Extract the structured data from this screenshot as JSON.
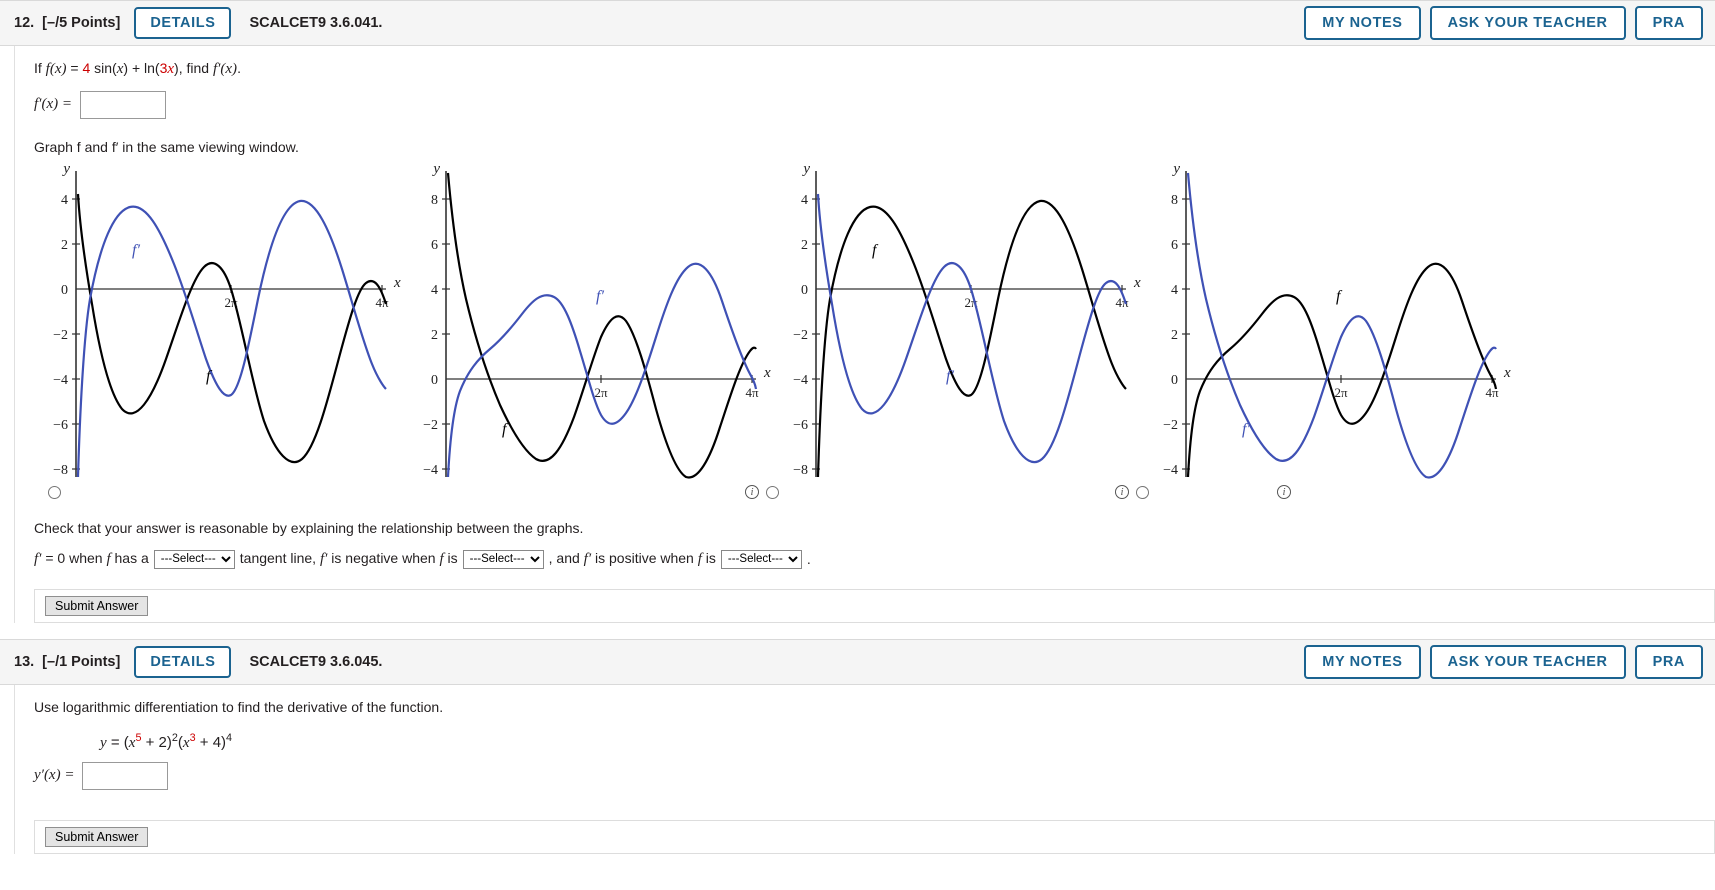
{
  "colors": {
    "accent_blue": "#1b6390",
    "curve_blue": "#3f51b5",
    "curve_black": "#000000",
    "red_text": "#cc0000",
    "header_bg": "#f5f5f5"
  },
  "questions": [
    {
      "number": "12.",
      "points": "[–/5 Points]",
      "details_label": "DETAILS",
      "code": "SCALCET9 3.6.041.",
      "header_buttons": [
        {
          "label": "MY NOTES"
        },
        {
          "label": "ASK YOUR TEACHER"
        },
        {
          "label": "PRA"
        }
      ],
      "prompt_parts": {
        "p1": "If ",
        "fx": "f(x)",
        "eq": " = ",
        "coef": "4",
        "sin": " sin(",
        "x1": "x",
        "mid": ") + ln(",
        "coef2": "3",
        "x2": "x",
        "tail": "), find ",
        "fprime": "f′(x)",
        "period": "."
      },
      "answer_label": "f′(x) =",
      "answer_value": "",
      "graph_instruction": "Graph f and f′ in the same viewing window.",
      "graphs": [
        {
          "id": "graph-option-1",
          "y_ticks": [
            "4",
            "2",
            "0",
            "−2",
            "−4",
            "−6",
            "−8"
          ],
          "x_ticks": [
            "2π",
            "4π"
          ],
          "axis_labels": {
            "x": "x",
            "y": "y"
          },
          "curve_labels": [
            {
              "text": "f′",
              "color": "blue"
            },
            {
              "text": "f",
              "color": "black"
            }
          ],
          "has_radio": true,
          "has_info": false
        },
        {
          "id": "graph-option-2",
          "y_ticks": [
            "8",
            "6",
            "4",
            "2",
            "0",
            "−2",
            "−4"
          ],
          "x_ticks": [
            "2π",
            "4π"
          ],
          "axis_labels": {
            "x": "x",
            "y": "y"
          },
          "curve_labels": [
            {
              "text": "f′",
              "color": "blue"
            },
            {
              "text": "f",
              "color": "black"
            }
          ],
          "has_radio": true,
          "has_info": true
        },
        {
          "id": "graph-option-3",
          "y_ticks": [
            "4",
            "2",
            "0",
            "−2",
            "−4",
            "−6",
            "−8"
          ],
          "x_ticks": [
            "2π",
            "4π"
          ],
          "axis_labels": {
            "x": "x",
            "y": "y"
          },
          "curve_labels": [
            {
              "text": "f",
              "color": "black"
            },
            {
              "text": "f′",
              "color": "blue"
            }
          ],
          "has_radio": true,
          "has_info": true
        },
        {
          "id": "graph-option-4",
          "y_ticks": [
            "8",
            "6",
            "4",
            "2",
            "0",
            "−2",
            "−4"
          ],
          "x_ticks": [
            "2π",
            "4π"
          ],
          "axis_labels": {
            "x": "x",
            "y": "y"
          },
          "curve_labels": [
            {
              "text": "f",
              "color": "black"
            },
            {
              "text": "f′",
              "color": "blue"
            }
          ],
          "has_radio": false,
          "has_info": true
        }
      ],
      "check_text": "Check that your answer is reasonable by explaining the relationship between the graphs.",
      "select_sentence": {
        "s1": "f′ = 0 when f has a",
        "s2": "tangent line, f′ is negative when f is",
        "s3": ", and f′ is positive when f is",
        "s4": "."
      },
      "select_placeholder": "---Select---",
      "select_options": [
        "---Select---"
      ],
      "submit_label": "Submit Answer"
    },
    {
      "number": "13.",
      "points": "[–/1 Points]",
      "details_label": "DETAILS",
      "code": "SCALCET9 3.6.045.",
      "header_buttons": [
        {
          "label": "MY NOTES"
        },
        {
          "label": "ASK YOUR TEACHER"
        },
        {
          "label": "PRA"
        }
      ],
      "prompt": "Use logarithmic differentiation to find the derivative of the function.",
      "equation": {
        "lhs": "y",
        "eq": " = (",
        "x1": "x",
        "exp1": "5",
        "mid1": " + 2)",
        "exp2": "2",
        "open2": "(",
        "x2": "x",
        "exp3": "3",
        "mid2": " + 4)",
        "exp4": "4"
      },
      "answer_label": "y′(x) =",
      "answer_value": "",
      "submit_label": "Submit Answer"
    }
  ]
}
